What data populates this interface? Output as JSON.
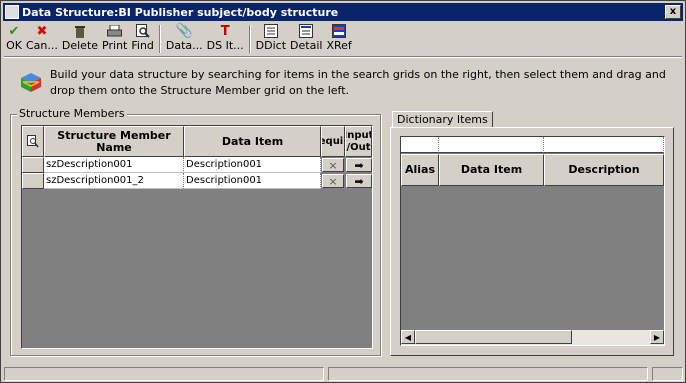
{
  "window": {
    "title": "Data Structure:BI Publisher subject/body structure",
    "close_glyph": "x"
  },
  "toolbar": [
    {
      "label": "OK",
      "icon": "checkmark-icon",
      "color": "#2e8b2e"
    },
    {
      "label": "Can...",
      "icon": "cancel-x-icon",
      "color": "#d00000"
    },
    {
      "label": "Delete",
      "icon": "trash-icon",
      "color": "#3a3a3a"
    },
    {
      "label": "Print",
      "icon": "printer-icon",
      "color": "#3a3a3a"
    },
    {
      "label": "Find",
      "icon": "find-icon",
      "color": "#3a3a3a"
    },
    {
      "label": "Data...",
      "icon": "paperclip-icon",
      "color": "#3a3a3a"
    },
    {
      "label": "DS It...",
      "icon": "ds-item-icon",
      "color": "#c00000"
    },
    {
      "label": "DDict",
      "icon": "data-dictionary-icon",
      "color": "#3a3a3a"
    },
    {
      "label": "Detail",
      "icon": "detail-icon",
      "color": "#3a3a3a"
    },
    {
      "label": "XRef",
      "icon": "xref-icon",
      "color": "#1a3fbf"
    }
  ],
  "info_text": "Build your data structure by searching for items in the search grids on the right, then select them and drag and drop them onto the Structure Member grid on the left.",
  "structure_members": {
    "group_label": "Structure Members",
    "columns": [
      "Structure Member Name",
      "Data Item",
      "Require",
      "Input /Out"
    ],
    "rows": [
      {
        "name": "szDescription001",
        "data_item": "Description001",
        "require": "×",
        "io": "➡"
      },
      {
        "name": "szDescription001_2",
        "data_item": "Description001",
        "require": "×",
        "io": "➡"
      }
    ]
  },
  "dictionary_items": {
    "tab_label": "Dictionary Items",
    "columns": [
      "Alias",
      "Data Item",
      "Description"
    ]
  }
}
